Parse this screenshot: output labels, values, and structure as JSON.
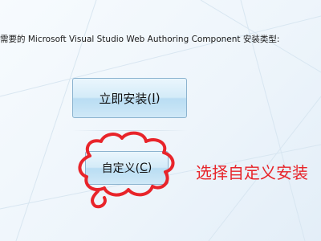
{
  "instruction": "需要的 Microsoft Visual Studio Web Authoring Component 安装类型:",
  "install_button": {
    "label": "立即安装(",
    "accesskey": "I",
    "close": ")"
  },
  "custom_button": {
    "label": "自定义(",
    "accesskey": "C",
    "close": ")"
  },
  "annotation": "选择自定义安装",
  "colors": {
    "annotation": "#e8242a",
    "button_border": "#8bb3cf"
  }
}
